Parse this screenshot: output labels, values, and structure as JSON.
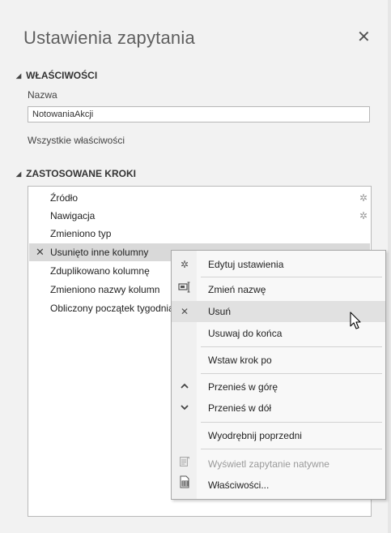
{
  "panel": {
    "title": "Ustawienia zapytania",
    "close_icon": "close-icon"
  },
  "properties": {
    "header": "WŁAŚCIWOŚCI",
    "name_label": "Nazwa",
    "name_value": "NotowaniaAkcji",
    "all_properties_link": "Wszystkie właściwości"
  },
  "applied_steps": {
    "header": "ZASTOSOWANE KROKI",
    "steps": [
      {
        "label": "Źródło",
        "has_gear": true,
        "selected": false
      },
      {
        "label": "Nawigacja",
        "has_gear": true,
        "selected": false
      },
      {
        "label": "Zmieniono typ",
        "has_gear": false,
        "selected": false
      },
      {
        "label": "Usunięto inne kolumny",
        "has_gear": false,
        "selected": true
      },
      {
        "label": "Zduplikowano kolumnę",
        "has_gear": false,
        "selected": false
      },
      {
        "label": "Zmieniono nazwy kolumn",
        "has_gear": false,
        "selected": false
      },
      {
        "label": "Obliczony początek tygodnia",
        "has_gear": false,
        "selected": false
      }
    ]
  },
  "context_menu": {
    "items": [
      {
        "label": "Edytuj ustawienia",
        "icon": "gear-icon"
      },
      {
        "label": "Zmień nazwę",
        "icon": "rename-icon"
      },
      {
        "label": "Usuń",
        "icon": "delete-x-icon"
      },
      {
        "label": "Usuwaj do końca",
        "icon": ""
      },
      {
        "label": "Wstaw krok po",
        "icon": ""
      },
      {
        "label": "Przenieś w górę",
        "icon": "chevron-up-icon"
      },
      {
        "label": "Przenieś w dół",
        "icon": "chevron-down-icon"
      },
      {
        "label": "Wyodrębnij poprzedni",
        "icon": ""
      },
      {
        "label": "Wyświetl zapytanie natywne",
        "icon": "native-query-icon",
        "disabled": true
      },
      {
        "label": "Właściwości...",
        "icon": "properties-icon"
      }
    ]
  },
  "colors": {
    "panel_bg": "#f2f2f2",
    "selected_step": "#d9d9d9",
    "menu_hover": "#e1e1e1"
  }
}
